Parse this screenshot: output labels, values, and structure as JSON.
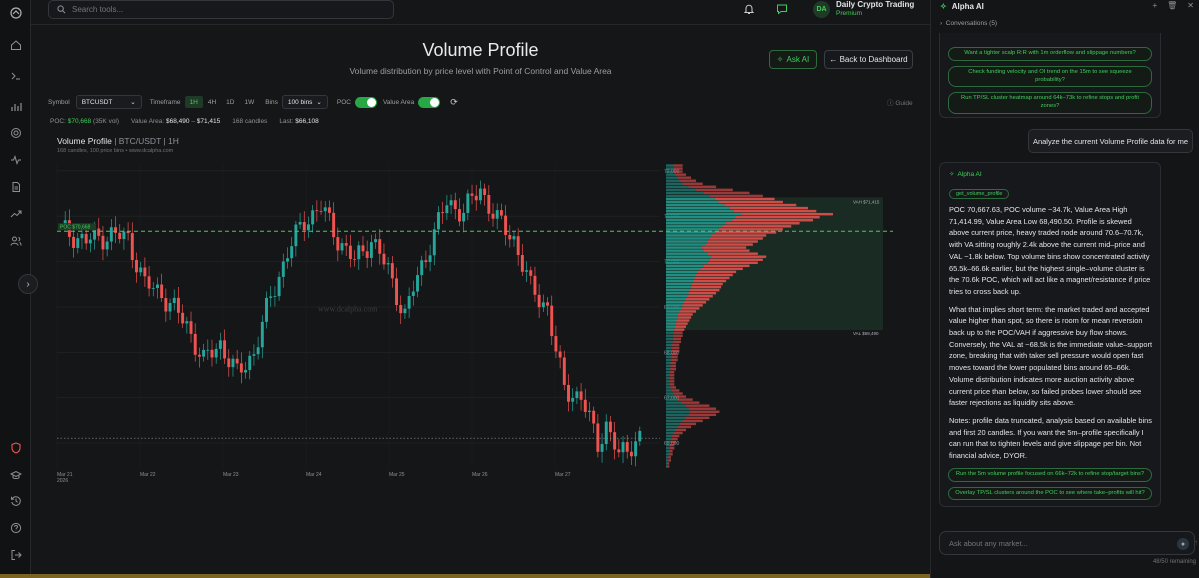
{
  "search": {
    "placeholder": "Search tools..."
  },
  "user": {
    "initials": "DA",
    "name": "Daily Crypto Trading",
    "plan": "Premium"
  },
  "page": {
    "title": "Volume Profile",
    "subtitle": "Volume distribution by price level with Point of Control and Value Area",
    "ask_ai": "Ask AI",
    "back": "← Back to Dashboard",
    "guide": "Guide"
  },
  "controls": {
    "symbol_label": "Symbol",
    "symbol_value": "BTCUSDT",
    "timeframe_label": "Timeframe",
    "timeframes": [
      "1H",
      "4H",
      "1D",
      "1W"
    ],
    "timeframe_selected": "1H",
    "bins_label": "Bins",
    "bins_value": "100 bins",
    "poc_label": "POC",
    "poc_on": true,
    "va_label": "Value Area",
    "va_on": true
  },
  "stats": {
    "poc_label": "POC:",
    "poc_value": "$70,668",
    "poc_vol": "(35K vol)",
    "va_label": "Value Area:",
    "va_low": "$68,490",
    "va_sep": "–",
    "va_high": "$71,415",
    "candles": "168 candles",
    "last_label": "Last:",
    "last_value": "$66,108"
  },
  "chart_header": {
    "title": "Volume Profile",
    "meta": "| BTC/USDT | 1H",
    "sub": "168 candles, 100 price bins • www.dcalpha.com"
  },
  "chart_data": {
    "type": "candlestick",
    "x_ticks": [
      "Mar 21\n2026",
      "Mar 22",
      "Mar 23",
      "Mar 24",
      "Mar 25",
      "Mar 26",
      "Mar 27"
    ],
    "y_ticks": [
      72000,
      71000,
      70000,
      69000,
      68000,
      67000,
      66000
    ],
    "ylim": [
      65450,
      72150
    ],
    "poc": 70668,
    "vah": 71415,
    "val": 68490,
    "last": 66108,
    "labels": {
      "poc": "POC $70,668",
      "vah": "VAH $71,415",
      "val": "VAL $68,490",
      "watermark": "www.dcalpha.com"
    },
    "colors": {
      "up": "#26a69a",
      "down": "#ef5350",
      "poc": "#3ecf5c"
    },
    "closes_keypoints": [
      [
        0,
        70700
      ],
      [
        6,
        70450
      ],
      [
        12,
        70600
      ],
      [
        16,
        70500
      ],
      [
        20,
        69500
      ],
      [
        24,
        69300
      ],
      [
        30,
        68600
      ],
      [
        34,
        67800
      ],
      [
        38,
        68200
      ],
      [
        42,
        67500
      ],
      [
        46,
        68000
      ],
      [
        50,
        69200
      ],
      [
        54,
        70200
      ],
      [
        58,
        70900
      ],
      [
        62,
        71200
      ],
      [
        66,
        70500
      ],
      [
        70,
        70000
      ],
      [
        74,
        70500
      ],
      [
        78,
        69800
      ],
      [
        82,
        68800
      ],
      [
        84,
        69400
      ],
      [
        88,
        70400
      ],
      [
        92,
        71300
      ],
      [
        96,
        71100
      ],
      [
        100,
        71600
      ],
      [
        104,
        70900
      ],
      [
        108,
        70500
      ],
      [
        112,
        69400
      ],
      [
        116,
        69000
      ],
      [
        118,
        68000
      ],
      [
        120,
        67200
      ],
      [
        124,
        67000
      ],
      [
        128,
        66000
      ],
      [
        130,
        66400
      ],
      [
        133,
        65700
      ],
      [
        136,
        66000
      ],
      [
        138,
        66100
      ]
    ],
    "profile_bins": [
      0.1,
      0.1,
      0.1,
      0.12,
      0.15,
      0.18,
      0.22,
      0.3,
      0.4,
      0.5,
      0.58,
      0.65,
      0.7,
      0.78,
      0.85,
      0.9,
      1.0,
      0.92,
      0.88,
      0.8,
      0.75,
      0.7,
      0.66,
      0.6,
      0.58,
      0.55,
      0.52,
      0.48,
      0.5,
      0.55,
      0.6,
      0.58,
      0.55,
      0.5,
      0.46,
      0.42,
      0.4,
      0.38,
      0.36,
      0.34,
      0.33,
      0.32,
      0.3,
      0.28,
      0.26,
      0.24,
      0.22,
      0.2,
      0.18,
      0.16,
      0.15,
      0.14,
      0.13,
      0.12,
      0.11,
      0.1,
      0.1,
      0.09,
      0.09,
      0.08,
      0.08,
      0.08,
      0.07,
      0.07,
      0.07,
      0.06,
      0.06,
      0.06,
      0.05,
      0.05,
      0.05,
      0.05,
      0.05,
      0.06,
      0.08,
      0.1,
      0.12,
      0.16,
      0.2,
      0.26,
      0.3,
      0.32,
      0.3,
      0.26,
      0.22,
      0.18,
      0.15,
      0.12,
      0.1,
      0.08,
      0.07,
      0.06,
      0.05,
      0.05,
      0.04,
      0.04,
      0.03,
      0.03,
      0.02,
      0.02
    ]
  },
  "panel": {
    "title": "Alpha AI",
    "conversations": "Conversations (5)",
    "top_chips": [
      "Want a tighter scalp R:R with 1m orderflow and slippage numbers?",
      "Check funding velocity and OI trend on the 15m to see squeeze probability?",
      "Run TP/SL cluster heatmap around 64k–73k to refine stops and profit zones?"
    ],
    "user_message": "Analyze the current Volume Profile data for me",
    "ai_name": "Alpha AI",
    "tool_name": "get_volume_profile",
    "paragraphs": [
      "POC 70,667.63, POC volume ~34.7k, Value Area High 71,414.99, Value Area Low 68,490.50. Profile is skewed above current price, heavy traded node around 70.6–70.7k, with VA sitting roughly 2.4k above the current mid–price and VAL ~1.8k below. Top volume bins show concentrated activity 65.5k–66.6k earlier, but the highest single–volume cluster is the 70.6k POC, which will act like a magnet/resistance if price tries to cross back up.",
      "What that implies short term: the market traded and accepted value higher than spot, so there is room for mean reversion back up to the POC/VAH if aggressive buy flow shows. Conversely, the VAL at ~68.5k is the immediate value–support zone, breaking that with taker sell pressure would open fast moves toward the lower populated bins around 65–66k. Volume distribution indicates more auction activity above current price than below, so failed probes lower should see faster rejections as liquidity sits above.",
      "Notes: profile data truncated, analysis based on available bins and first 20 candles. If you want the 5m–profile specifically I can run that to tighten levels and give slippage per bin. Not financial advice, DYOR."
    ],
    "bottom_chips": [
      "Run the 5m volume profile focused on 66k–72k to refine stop/target bins?",
      "Overlay TP/SL clusters around the POC to see where take–profits will hit?"
    ],
    "input_placeholder": "Ask about any market...",
    "remaining": "48/50 remaining"
  }
}
